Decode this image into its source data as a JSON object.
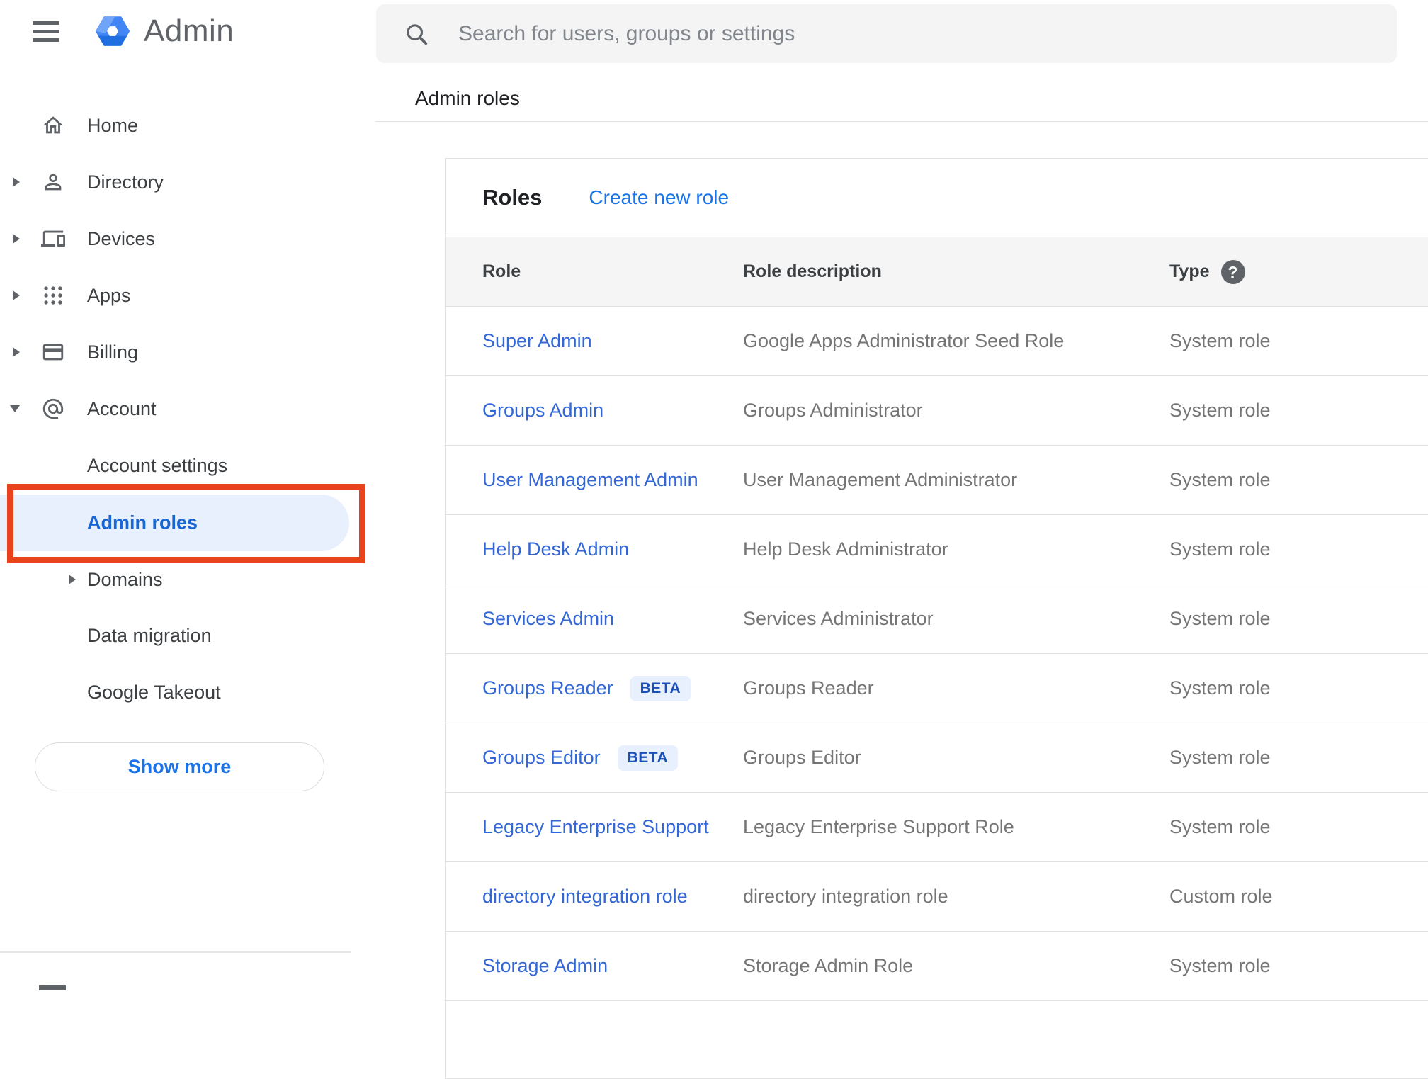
{
  "app": {
    "logo_text": "Admin"
  },
  "search": {
    "placeholder": "Search for users, groups or settings"
  },
  "breadcrumb": "Admin roles",
  "sidebar": {
    "items": [
      {
        "label": "Home"
      },
      {
        "label": "Directory"
      },
      {
        "label": "Devices"
      },
      {
        "label": "Apps"
      },
      {
        "label": "Billing"
      },
      {
        "label": "Account"
      },
      {
        "label": "Account settings"
      },
      {
        "label": "Admin roles",
        "selected": true
      },
      {
        "label": "Domains"
      },
      {
        "label": "Data migration"
      },
      {
        "label": "Google Takeout"
      }
    ],
    "show_more_label": "Show more"
  },
  "roles_panel": {
    "title": "Roles",
    "create_link": "Create new role",
    "columns": {
      "role": "Role",
      "description": "Role description",
      "type": "Type"
    },
    "type_help_glyph": "?",
    "beta_label": "BETA",
    "rows": [
      {
        "role": "Super Admin",
        "description": "Google Apps Administrator Seed Role",
        "type": "System role"
      },
      {
        "role": "Groups Admin",
        "description": "Groups Administrator",
        "type": "System role"
      },
      {
        "role": "User Management Admin",
        "description": "User Management Administrator",
        "type": "System role"
      },
      {
        "role": "Help Desk Admin",
        "description": "Help Desk Administrator",
        "type": "System role"
      },
      {
        "role": "Services Admin",
        "description": "Services Administrator",
        "type": "System role"
      },
      {
        "role": "Groups Reader",
        "beta": true,
        "description": "Groups Reader",
        "type": "System role"
      },
      {
        "role": "Groups Editor",
        "beta": true,
        "description": "Groups Editor",
        "type": "System role"
      },
      {
        "role": "Legacy Enterprise Support",
        "description": "Legacy Enterprise Support Role",
        "type": "System role"
      },
      {
        "role": "directory integration role",
        "description": "directory integration role",
        "type": "Custom role"
      },
      {
        "role": "Storage Admin",
        "description": "Storage Admin Role",
        "type": "System role"
      }
    ]
  },
  "colors": {
    "annotation_red": "#e8431c",
    "selected_item_bg": "#e8f0fe",
    "selected_item_text": "#1967d2",
    "link_blue": "#1a73e8",
    "role_link_blue": "#3367d6",
    "beta_badge_bg": "#e8f0fe",
    "beta_badge_text": "#1a4fb8",
    "table_header_bg": "#f5f5f5"
  }
}
